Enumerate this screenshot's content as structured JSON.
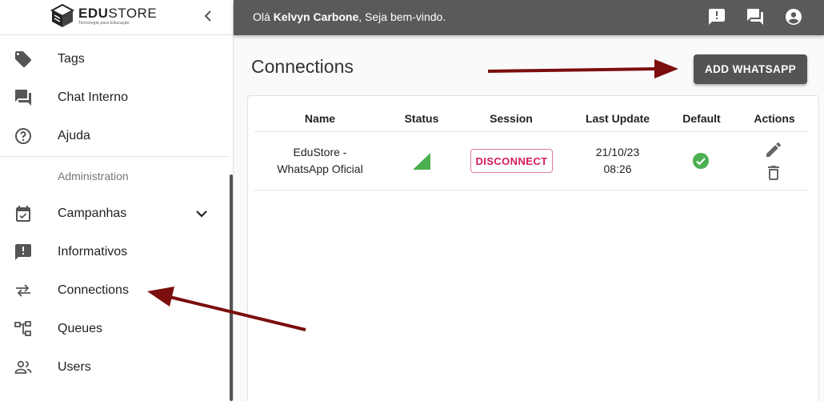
{
  "logo": {
    "brand_bold": "EDU",
    "brand_light": "STORE",
    "tagline": "Tecnologia para Educação"
  },
  "sidebar": {
    "items": [
      {
        "label": "Tags",
        "icon": "tag-icon"
      },
      {
        "label": "Chat Interno",
        "icon": "forum-icon"
      },
      {
        "label": "Ajuda",
        "icon": "help-circle-icon"
      }
    ],
    "section_label": "Administration",
    "admin_items": [
      {
        "label": "Campanhas",
        "icon": "event-available-icon"
      },
      {
        "label": "Informativos",
        "icon": "announcement-icon"
      },
      {
        "label": "Connections",
        "icon": "sync-alt-icon"
      },
      {
        "label": "Queues",
        "icon": "account-tree-icon"
      },
      {
        "label": "Users",
        "icon": "people-icon"
      }
    ]
  },
  "topbar": {
    "greeting_prefix": "Olá ",
    "user_name": "Kelvyn Carbone",
    "greeting_suffix": ", Seja bem-vindo.",
    "icons": [
      "announcement-icon",
      "forum-icon",
      "account-circle-icon"
    ],
    "color": "#5a5a5a"
  },
  "main": {
    "title": "Connections",
    "add_button": "ADD WHATSAPP",
    "table": {
      "columns": [
        "Name",
        "Status",
        "Session",
        "Last Update",
        "Default",
        "Actions"
      ],
      "rows": [
        {
          "name_line1": "EduStore -",
          "name_line2": "WhatsApp Oficial",
          "status": "signal-icon",
          "session": "DISCONNECT",
          "date": "21/10/23",
          "time": "08:26",
          "default": "check-circle-icon",
          "actions": [
            "edit-icon",
            "delete-icon"
          ]
        }
      ]
    }
  },
  "colors": {
    "accent": "#d81b60",
    "status_green": "#4caf50",
    "arrow": "#7b0e0e"
  }
}
